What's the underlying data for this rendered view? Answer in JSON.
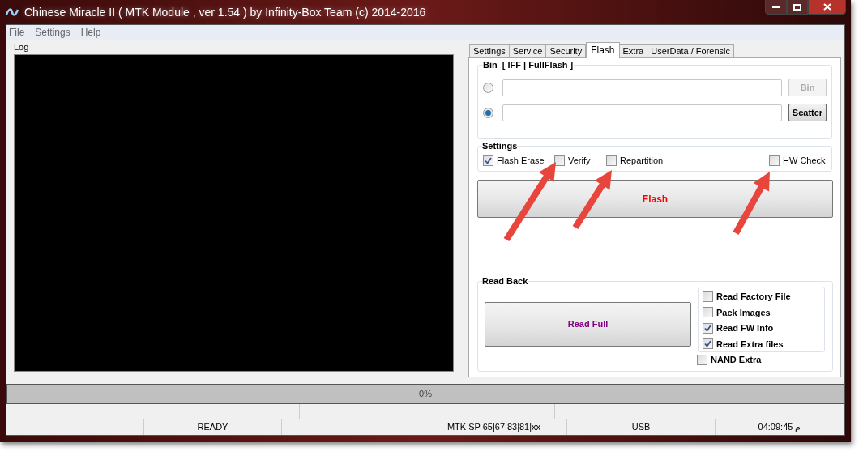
{
  "window": {
    "title": "Chinese Miracle II ( MTK Module , ver 1.54 ) by Infinity-Box Team (c) 2014-2016"
  },
  "menu": [
    "File",
    "Settings",
    "Help"
  ],
  "log": {
    "label": "Log"
  },
  "tabs": [
    {
      "label": "Settings",
      "selected": false
    },
    {
      "label": "Service",
      "selected": false
    },
    {
      "label": "Security",
      "selected": false
    },
    {
      "label": "Flash",
      "selected": true
    },
    {
      "label": "Extra",
      "selected": false
    },
    {
      "label": "UserData / Forensic",
      "selected": false
    }
  ],
  "bin_group": {
    "title": "Bin  [ IFF | FullFlash ]",
    "rows": [
      {
        "selected": false,
        "button": "Bin",
        "disabled": true
      },
      {
        "selected": true,
        "button": "Scatter",
        "disabled": false
      }
    ]
  },
  "settings": {
    "title": "Settings",
    "options": [
      {
        "label": "Flash Erase",
        "checked": true
      },
      {
        "label": "Verify",
        "checked": false
      },
      {
        "label": "Repartition",
        "checked": false
      },
      {
        "label": "HW Check",
        "checked": false
      }
    ]
  },
  "flash_button": "Flash",
  "read_back": {
    "title": "Read Back",
    "button": "Read Full",
    "options": [
      {
        "label": "Read Factory File",
        "checked": false
      },
      {
        "label": "Pack Images",
        "checked": false
      },
      {
        "label": "Read FW Info",
        "checked": true
      },
      {
        "label": "Read Extra files",
        "checked": true
      }
    ],
    "nand_extra": {
      "label": "NAND Extra",
      "checked": false
    }
  },
  "progress": {
    "text": "0%"
  },
  "status_bar": [
    "READY",
    "MTK SP 65|67|83|81|xx",
    "USB",
    "04:09:45 م"
  ]
}
